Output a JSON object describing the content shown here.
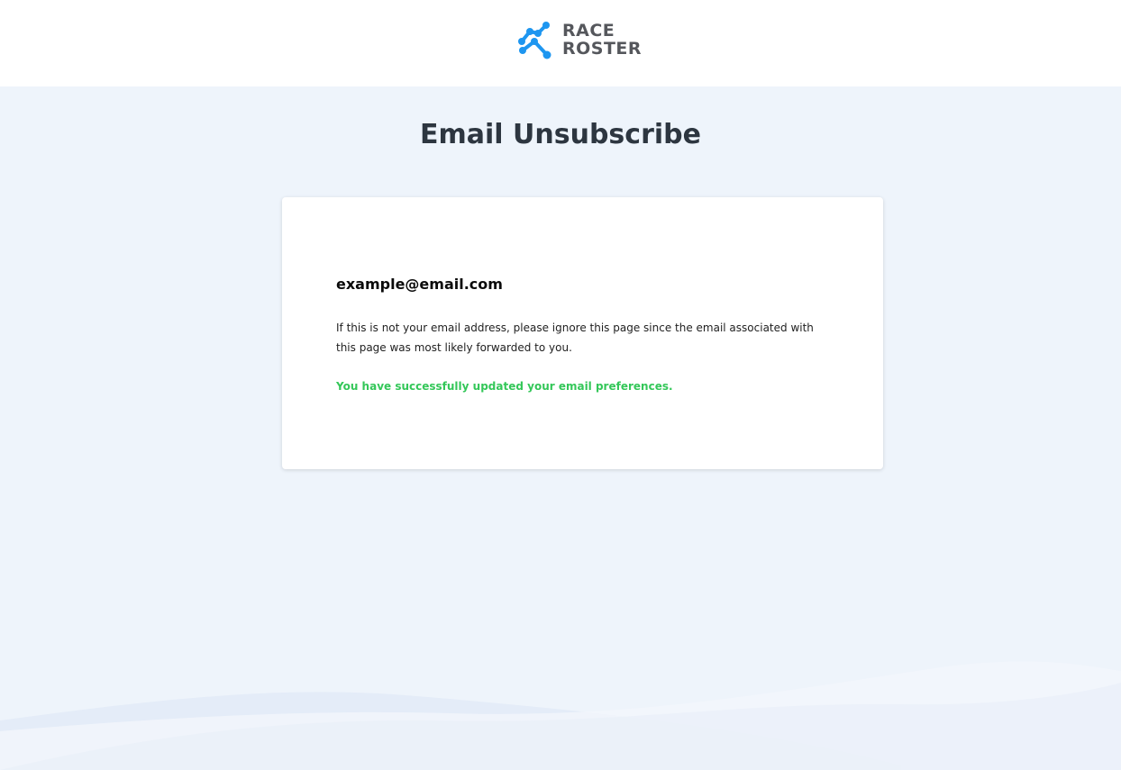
{
  "header": {
    "logo": {
      "line1": "RACE",
      "line2": "ROSTER",
      "icon": "race-roster-logo-icon"
    }
  },
  "main": {
    "title": "Email Unsubscribe",
    "card": {
      "email": "example@email.com",
      "notice": "If this is not your email address, please ignore this page since the email associated with this page was most likely forwarded to you.",
      "success": "You have successfully updated your email preferences."
    }
  },
  "colors": {
    "background": "#eef4fb",
    "brand_blue": "#1e96f0",
    "logo_text": "#55575c",
    "title": "#2d3640",
    "success": "#34c759"
  }
}
